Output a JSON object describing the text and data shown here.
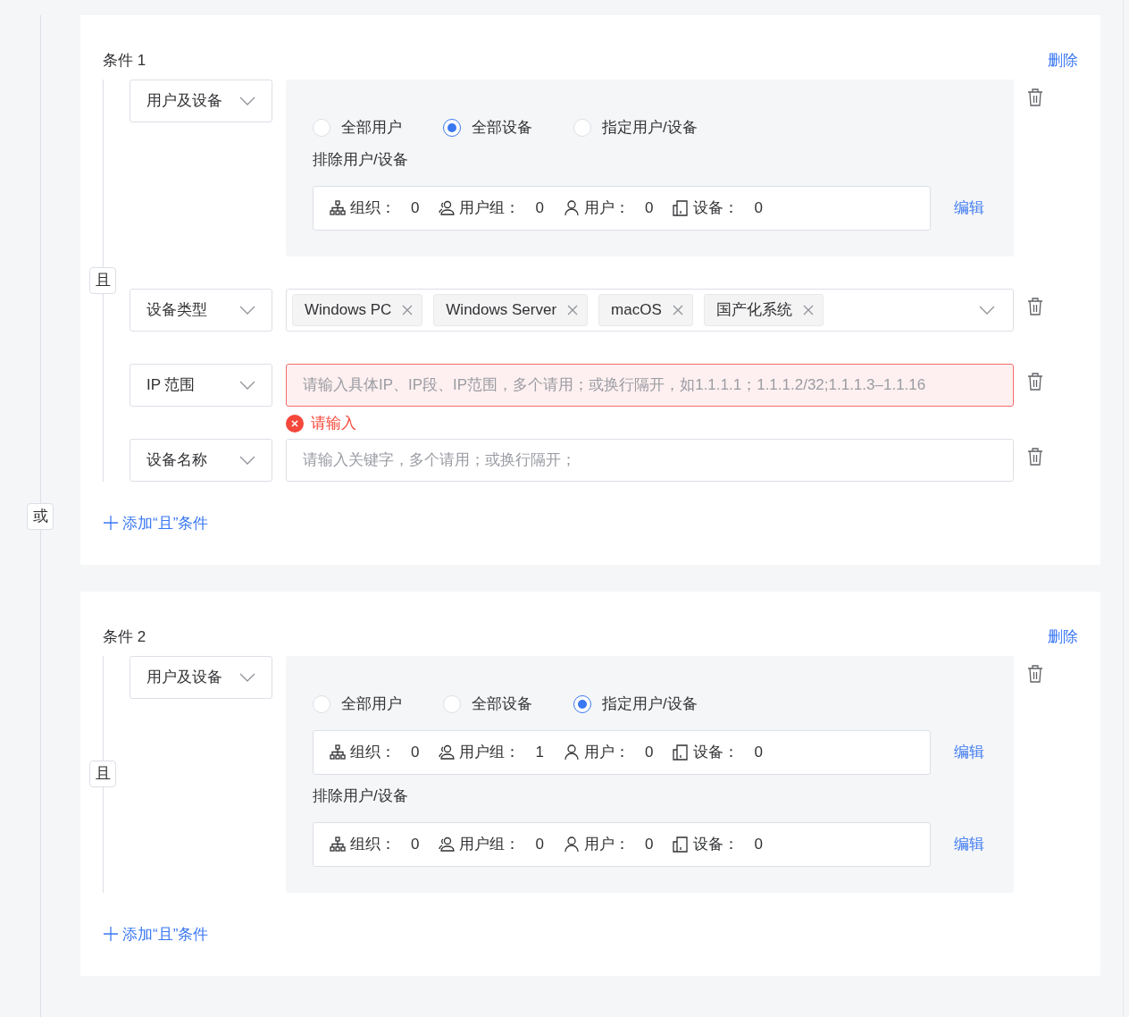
{
  "or_label": "或",
  "conditions": [
    {
      "title": "条件 1",
      "delete": "删除",
      "and_label": "且",
      "add_and": "添加“且”条件",
      "rules": [
        {
          "kind": "user_device",
          "field": "用户及设备",
          "options": [
            {
              "label": "全部用户",
              "selected": false
            },
            {
              "label": "全部设备",
              "selected": true
            },
            {
              "label": "指定用户/设备",
              "selected": false
            }
          ],
          "summaries": [
            {
              "heading": "排除用户/设备",
              "edit": "编辑",
              "stats": [
                {
                  "kind": "org",
                  "label": "组织：",
                  "value": "0"
                },
                {
                  "kind": "group",
                  "label": "用户组：",
                  "value": "0"
                },
                {
                  "kind": "user",
                  "label": "用户：",
                  "value": "0"
                },
                {
                  "kind": "device",
                  "label": "设备：",
                  "value": "0"
                }
              ]
            }
          ]
        },
        {
          "kind": "tags",
          "field": "设备类型",
          "tags": [
            "Windows PC",
            "Windows Server",
            "macOS",
            "国产化系统"
          ]
        },
        {
          "kind": "text",
          "field": "IP 范围",
          "placeholder": "请输入具体IP、IP段、IP范围，多个请用；或换行隔开，如1.1.1.1；1.1.1.2/32;1.1.1.3–1.1.16",
          "invalid": true,
          "error": "请输入"
        },
        {
          "kind": "text",
          "field": "设备名称",
          "placeholder": "请输入关键字，多个请用；或换行隔开；",
          "invalid": false
        }
      ]
    },
    {
      "title": "条件 2",
      "delete": "删除",
      "and_label": "且",
      "add_and": "添加“且”条件",
      "rules": [
        {
          "kind": "user_device",
          "field": "用户及设备",
          "options": [
            {
              "label": "全部用户",
              "selected": false
            },
            {
              "label": "全部设备",
              "selected": false
            },
            {
              "label": "指定用户/设备",
              "selected": true
            }
          ],
          "summaries": [
            {
              "edit": "编辑",
              "stats": [
                {
                  "kind": "org",
                  "label": "组织：",
                  "value": "0"
                },
                {
                  "kind": "group",
                  "label": "用户组：",
                  "value": "1"
                },
                {
                  "kind": "user",
                  "label": "用户：",
                  "value": "0"
                },
                {
                  "kind": "device",
                  "label": "设备：",
                  "value": "0"
                }
              ]
            },
            {
              "heading": "排除用户/设备",
              "edit": "编辑",
              "stats": [
                {
                  "kind": "org",
                  "label": "组织：",
                  "value": "0"
                },
                {
                  "kind": "group",
                  "label": "用户组：",
                  "value": "0"
                },
                {
                  "kind": "user",
                  "label": "用户：",
                  "value": "0"
                },
                {
                  "kind": "device",
                  "label": "设备：",
                  "value": "0"
                }
              ]
            }
          ]
        }
      ]
    }
  ]
}
